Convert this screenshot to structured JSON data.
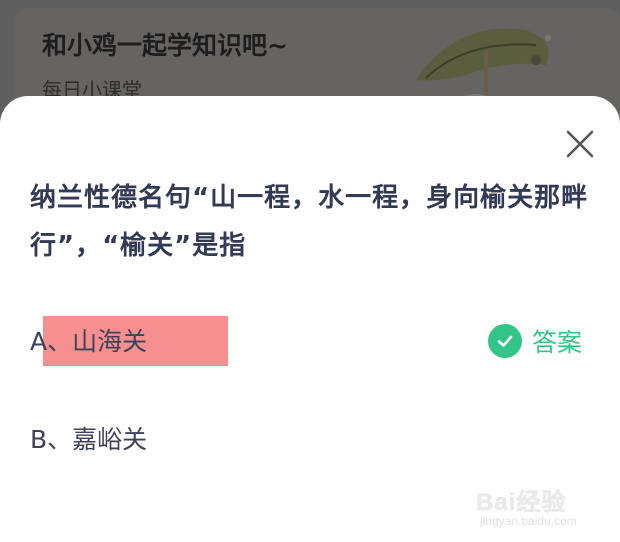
{
  "background": {
    "title": "和小鸡一起学知识吧~",
    "subtitle": "每日小课堂"
  },
  "question": {
    "text": "纳兰性德名句“山一程，水一程，身向榆关那畔行”，“榆关”是指"
  },
  "options": [
    {
      "label": "A、山海关",
      "highlighted": true
    },
    {
      "label": "B、嘉峪关",
      "highlighted": false
    }
  ],
  "answer": {
    "label": "答案",
    "icon": "check-circle-icon",
    "color": "#33c587"
  },
  "watermark": {
    "logo": "Bai经验",
    "url": "jingyan.baidu.com"
  },
  "colors": {
    "highlight": "#f68f8f",
    "question_text": "#333a55",
    "accent_green": "#33c587"
  }
}
